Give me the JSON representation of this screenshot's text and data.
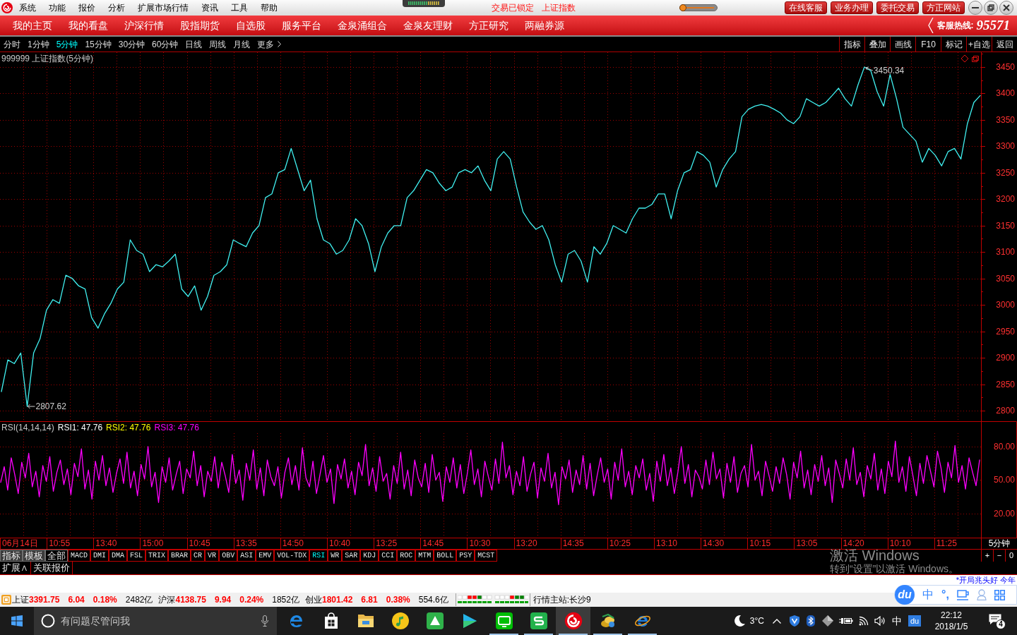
{
  "title_bar": {
    "menu": [
      "系统",
      "功能",
      "报价",
      "分析",
      "扩展市场行情",
      "资讯",
      "工具",
      "帮助"
    ],
    "lock_status": "交易已锁定",
    "index_name": "上证指数",
    "opacity_slider": {
      "level": 0
    },
    "buttons": [
      "在线客服",
      "业务办理",
      "委托交易",
      "方正网站"
    ]
  },
  "nav_bar": {
    "items": [
      "我的主页",
      "我的看盘",
      "沪深行情",
      "股指期货",
      "自选股",
      "服务平台",
      "金泉涌组合",
      "金泉友理财",
      "方正研究",
      "两融券源"
    ],
    "hotline_label": "客服热线:",
    "hotline_number": "95571"
  },
  "period_bar": {
    "periods": [
      {
        "label": "分时",
        "selected": false
      },
      {
        "label": "1分钟",
        "selected": false
      },
      {
        "label": "5分钟",
        "selected": true
      },
      {
        "label": "15分钟",
        "selected": false
      },
      {
        "label": "30分钟",
        "selected": false
      },
      {
        "label": "60分钟",
        "selected": false
      },
      {
        "label": "日线",
        "selected": false
      },
      {
        "label": "周线",
        "selected": false
      },
      {
        "label": "月线",
        "selected": false
      }
    ],
    "more": "更多",
    "tools": [
      "指标",
      "叠加",
      "画线",
      "F10",
      "标记",
      "+自选",
      "返回"
    ]
  },
  "price_chart": {
    "title": "999999 上证指数(5分钟)",
    "high_label": "3450.34",
    "low_label": "2807.62",
    "chart_data": {
      "type": "line",
      "grid": true,
      "series": [
        {
          "color": "#40f0f0",
          "values": [
            2836,
            2896,
            2889,
            2909,
            2808,
            2909,
            2936,
            2990,
            3010,
            3003,
            3056,
            3050,
            3036,
            3030,
            2976,
            2956,
            2983,
            3003,
            3030,
            3043,
            3123,
            3103,
            3096,
            3063,
            3076,
            3072,
            3083,
            3096,
            3030,
            3016,
            3036,
            2990,
            3016,
            3056,
            3063,
            3076,
            3123,
            3116,
            3110,
            3136,
            3150,
            3203,
            3210,
            3250,
            3256,
            3296,
            3256,
            3216,
            3236,
            3163,
            3123,
            3116,
            3096,
            3103,
            3123,
            3163,
            3150,
            3116,
            3063,
            3110,
            3136,
            3150,
            3150,
            3203,
            3216,
            3236,
            3256,
            3250,
            3230,
            3216,
            3223,
            3250,
            3256,
            3250,
            3263,
            3236,
            3216,
            3276,
            3290,
            3276,
            3223,
            3176,
            3157,
            3143,
            3150,
            3123,
            3076,
            3043,
            3096,
            3103,
            3083,
            3043,
            3110,
            3096,
            3116,
            3150,
            3143,
            3136,
            3163,
            3183,
            3183,
            3190,
            3210,
            3210,
            3163,
            3216,
            3250,
            3256,
            3290,
            3283,
            3270,
            3223,
            3256,
            3276,
            3290,
            3356,
            3370,
            3376,
            3379,
            3376,
            3370,
            3363,
            3350,
            3343,
            3356,
            3390,
            3383,
            3376,
            3383,
            3396,
            3410,
            3390,
            3376,
            3416,
            3450,
            3443,
            3403,
            3376,
            3436,
            3390,
            3336,
            3323,
            3310,
            3270,
            3296,
            3283,
            3263,
            3290,
            3296,
            3276,
            3343,
            3383,
            3396
          ]
        }
      ],
      "ylim": [
        2780,
        3478
      ],
      "yticks": [
        2800,
        2850,
        2900,
        2950,
        3000,
        3050,
        3100,
        3150,
        3200,
        3250,
        3300,
        3350,
        3400,
        3450
      ]
    }
  },
  "rsi_pane": {
    "label": "RSI(14,14,14)",
    "readings": [
      {
        "text": "RSI1: 47.76",
        "color": "#ffffff"
      },
      {
        "text": "RSI2: 47.76",
        "color": "#ffff00"
      },
      {
        "text": "RSI3: 47.76",
        "color": "#ff00ff"
      }
    ],
    "chart_data": {
      "type": "line",
      "grid": true,
      "series": [
        {
          "color": "#ff00ff",
          "values": [
            48,
            62,
            41,
            70,
            55,
            38,
            66,
            52,
            74,
            44,
            58,
            35,
            63,
            49,
            71,
            40,
            57,
            68,
            46,
            60,
            37,
            65,
            53,
            78,
            42,
            59,
            33,
            67,
            50,
            72,
            45,
            61,
            39,
            56,
            69,
            47,
            75,
            43,
            58,
            36,
            64,
            51,
            80,
            44,
            57,
            30,
            62,
            48,
            70,
            41,
            55,
            67,
            38,
            60,
            52,
            76,
            45,
            63,
            35,
            58,
            49,
            71,
            43,
            66,
            54,
            39,
            73,
            47,
            59,
            32,
            65,
            50,
            77,
            42,
            61,
            36,
            68,
            53,
            45,
            62,
            34,
            57,
            70,
            46,
            63,
            41,
            79,
            52,
            44,
            67,
            38,
            55,
            72,
            48,
            60,
            29,
            64,
            51,
            69,
            43,
            58,
            37,
            66,
            54,
            82,
            45,
            61,
            40,
            71,
            49,
            56,
            33,
            63,
            47,
            75,
            42,
            59,
            36,
            68,
            52,
            44,
            65,
            39,
            73,
            50,
            57,
            31,
            62,
            48,
            70,
            43,
            64,
            38,
            56,
            77,
            46,
            60,
            35,
            67,
            53,
            41,
            69,
            47,
            84,
            52,
            63,
            37,
            58,
            45,
            71,
            40,
            55,
            66,
            34,
            61,
            49,
            74,
            43,
            57,
            28,
            62,
            51,
            68,
            39,
            59,
            46,
            72,
            42,
            65,
            36,
            54,
            70,
            48,
            60,
            33,
            66,
            50,
            78,
            44,
            58,
            37,
            63,
            52,
            69,
            41,
            56,
            31,
            67,
            49,
            73,
            45,
            61,
            38,
            57,
            80,
            47,
            64,
            35,
            59,
            53,
            42,
            68,
            46,
            75,
            51,
            60,
            34,
            65,
            48,
            71,
            39,
            56,
            63,
            44,
            82,
            50,
            58,
            36,
            67,
            54,
            40,
            62,
            47,
            70,
            55,
            33,
            66,
            52,
            76,
            43,
            59,
            37,
            64,
            49,
            72,
            45,
            61,
            30,
            68,
            56,
            43,
            69,
            50,
            79,
            46,
            57,
            35,
            63,
            51,
            74,
            41,
            60,
            38,
            67,
            53,
            85,
            48,
            62,
            40,
            71,
            54,
            36,
            65,
            47,
            72,
            58,
            44,
            76,
            61,
            39,
            66,
            52,
            81,
            48,
            63,
            42,
            70,
            57,
            45,
            68
          ]
        }
      ],
      "ylim": [
        -1.8,
        102.4
      ],
      "yticks": [
        {
          "value": 80,
          "label": "80.00"
        },
        {
          "value": 50,
          "label": "50.00"
        },
        {
          "value": 20,
          "label": "20.00"
        }
      ]
    }
  },
  "time_axis": {
    "labels": [
      "06月14日",
      "10:55",
      "13:40",
      "15:00",
      "10:45",
      "13:35",
      "14:50",
      "10:40",
      "13:25",
      "14:45",
      "10:30",
      "13:20",
      "14:35",
      "10:25",
      "13:10",
      "14:30",
      "10:15",
      "13:05",
      "14:20",
      "10:10",
      "11:25"
    ],
    "period": "5分钟"
  },
  "indicator_bar": {
    "items": [
      {
        "label": "指标",
        "kind": "menu",
        "selected": false
      },
      {
        "label": "模板",
        "kind": "menu",
        "selected": false
      },
      {
        "label": "全部",
        "kind": "group",
        "selected": false
      },
      {
        "label": "MACD",
        "kind": "tab",
        "selected": false
      },
      {
        "label": "DMI",
        "kind": "tab",
        "selected": false
      },
      {
        "label": "DMA",
        "kind": "tab",
        "selected": false
      },
      {
        "label": "FSL",
        "kind": "tab",
        "selected": false
      },
      {
        "label": "TRIX",
        "kind": "tab",
        "selected": false
      },
      {
        "label": "BRAR",
        "kind": "tab",
        "selected": false
      },
      {
        "label": "CR",
        "kind": "tab",
        "selected": false
      },
      {
        "label": "VR",
        "kind": "tab",
        "selected": false
      },
      {
        "label": "OBV",
        "kind": "tab",
        "selected": false
      },
      {
        "label": "ASI",
        "kind": "tab",
        "selected": false
      },
      {
        "label": "EMV",
        "kind": "tab",
        "selected": false
      },
      {
        "label": "VOL-TDX",
        "kind": "tab",
        "selected": false
      },
      {
        "label": "RSI",
        "kind": "tab",
        "selected": true
      },
      {
        "label": "WR",
        "kind": "tab",
        "selected": false
      },
      {
        "label": "SAR",
        "kind": "tab",
        "selected": false
      },
      {
        "label": "KDJ",
        "kind": "tab",
        "selected": false
      },
      {
        "label": "CCI",
        "kind": "tab",
        "selected": false
      },
      {
        "label": "ROC",
        "kind": "tab",
        "selected": false
      },
      {
        "label": "MTM",
        "kind": "tab",
        "selected": false
      },
      {
        "label": "BOLL",
        "kind": "tab",
        "selected": false
      },
      {
        "label": "PSY",
        "kind": "tab",
        "selected": false
      },
      {
        "label": "MCST",
        "kind": "tab",
        "selected": false
      }
    ],
    "zoom_buttons": [
      "+",
      "−",
      "0"
    ]
  },
  "extension_bar": {
    "items": [
      "扩展∧",
      "关联报价"
    ]
  },
  "ticker": {
    "text": "*开局兆头好 今年"
  },
  "status_bar": {
    "indices": [
      {
        "name": "上证",
        "price": "3391.75",
        "change": "6.04",
        "percent": "0.18%",
        "turnover": "2482亿"
      },
      {
        "name": "沪深",
        "price": "4138.75",
        "change": "9.94",
        "percent": "0.24%",
        "turnover": "1852亿"
      },
      {
        "name": "创业",
        "price": "1801.42",
        "change": "6.81",
        "percent": "0.38%",
        "turnover": "554.6亿"
      }
    ],
    "server": "行情主站:长沙9"
  },
  "watermark": {
    "title": "激活 Windows",
    "hint": "转到“设置”以激活 Windows。"
  },
  "ime_toolbar": {
    "logo": "du",
    "mode": "中",
    "punctuation": "°,"
  },
  "taskbar": {
    "search_placeholder": "有问题尽管问我",
    "apps": [
      {
        "kind": "e-browser",
        "selected": false,
        "running": false
      },
      {
        "kind": "bag",
        "selected": false,
        "running": false
      },
      {
        "kind": "folder",
        "selected": false,
        "running": false
      },
      {
        "kind": "music-disc",
        "selected": false,
        "running": false
      },
      {
        "kind": "green-tile",
        "selected": false,
        "running": false
      },
      {
        "kind": "play",
        "selected": false,
        "running": false
      },
      {
        "kind": "tv-tile",
        "selected": false,
        "running": true
      },
      {
        "kind": "s-tile",
        "selected": false,
        "running": true
      },
      {
        "kind": "swirl",
        "selected": true,
        "running": true
      },
      {
        "kind": "coins",
        "selected": false,
        "running": true
      },
      {
        "kind": "e-globe",
        "selected": false,
        "running": true
      }
    ],
    "weather": "3°C",
    "ime": "中",
    "ime_logo": "du",
    "time": "22:12",
    "date": "2018/1/5",
    "notifications": "4"
  }
}
